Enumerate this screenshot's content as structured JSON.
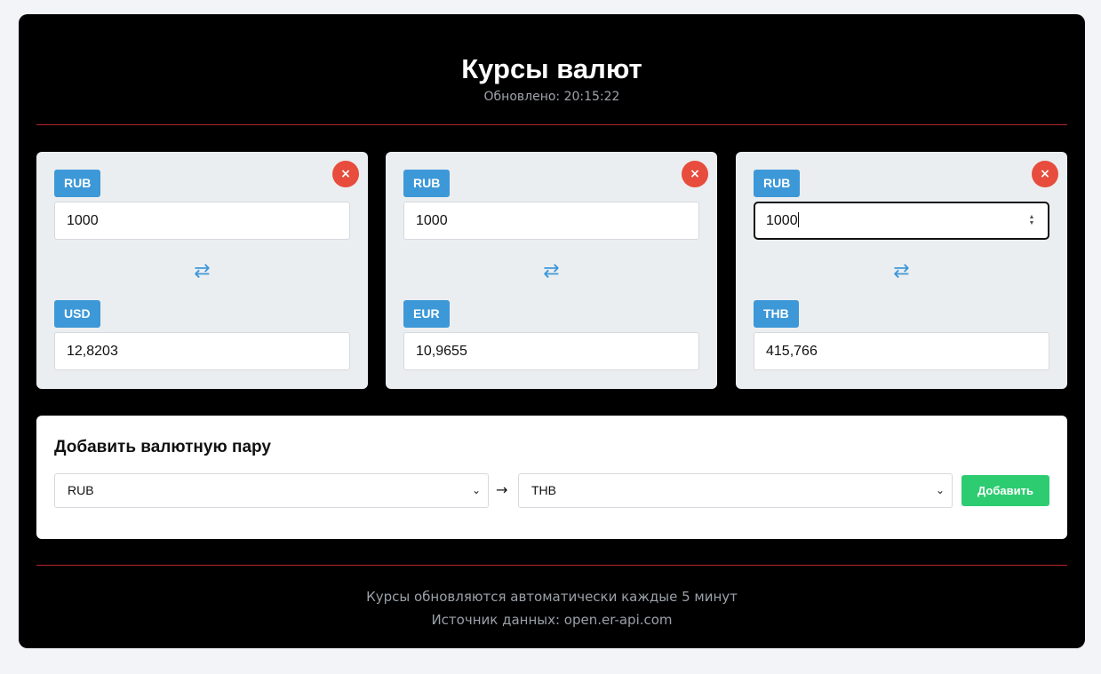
{
  "header": {
    "title": "Курсы валют",
    "updated": "Обновлено: 20:15:22"
  },
  "pairs": [
    {
      "from_code": "RUB",
      "from_value": "1000",
      "to_code": "USD",
      "to_value": "12,8203",
      "swap_icon": "swap-arrows-icon",
      "remove_icon": "close-icon",
      "remove_label": "×"
    },
    {
      "from_code": "RUB",
      "from_value": "1000",
      "to_code": "EUR",
      "to_value": "10,9655",
      "swap_icon": "swap-arrows-icon",
      "remove_icon": "close-icon",
      "remove_label": "×"
    },
    {
      "from_code": "RUB",
      "from_value": "1000",
      "to_code": "THB",
      "to_value": "415,766",
      "swap_icon": "swap-arrows-icon",
      "remove_icon": "close-icon",
      "remove_label": "×"
    }
  ],
  "add_pair": {
    "title": "Добавить валютную пару",
    "from_selected": "RUB",
    "to_selected": "THB",
    "arrow": "→",
    "button_label": "Добавить"
  },
  "footer": {
    "line1": "Курсы обновляются автоматически каждые 5 минут",
    "line2": "Источник данных: open.er-api.com"
  },
  "colors": {
    "accent": "#3d98d8",
    "danger": "#e74c3c",
    "success": "#2ecc71",
    "separator": "#b3242b"
  }
}
